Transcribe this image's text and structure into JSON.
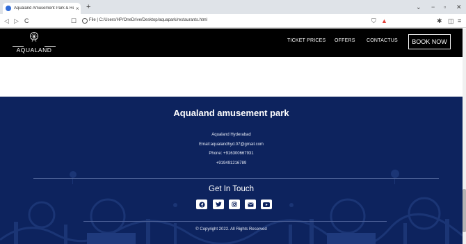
{
  "browser": {
    "tab_title": "Aqualand Amusement Park & Re",
    "tab_close": "×",
    "new_tab": "+",
    "url": "File  |  C:/Users/HP/OneDrive/Desktop/aquapark/restaurants.html",
    "window_controls": {
      "minimize": "−",
      "maximize": "▫",
      "close": "✕",
      "dropdown": "⌄"
    },
    "nav": {
      "back": "◁",
      "forward": "▷",
      "reload": "C",
      "bookmark": "☐"
    }
  },
  "site": {
    "logo_text": "AQUALAND",
    "nav": [
      "TICKET PRICES",
      "OFFERS",
      "CONTACTUS"
    ],
    "book_label": "BOOK NOW"
  },
  "footer": {
    "title": "Aqualand amusement park",
    "contact": [
      "Aqualand Hyderabad",
      "Email:aqualandhyd.07@gmail.com",
      "Phone: +916300667931",
      "+919491216789"
    ],
    "touch_title": "Get In Touch",
    "social": [
      "facebook-icon",
      "twitter-icon",
      "instagram-icon",
      "email-icon",
      "youtube-icon"
    ],
    "copyright": "© Copyright 2022. All Rights Reserved"
  },
  "colors": {
    "header_bg": "#000000",
    "footer_bg": "#0d235e",
    "accent_red": "#e2433b"
  }
}
